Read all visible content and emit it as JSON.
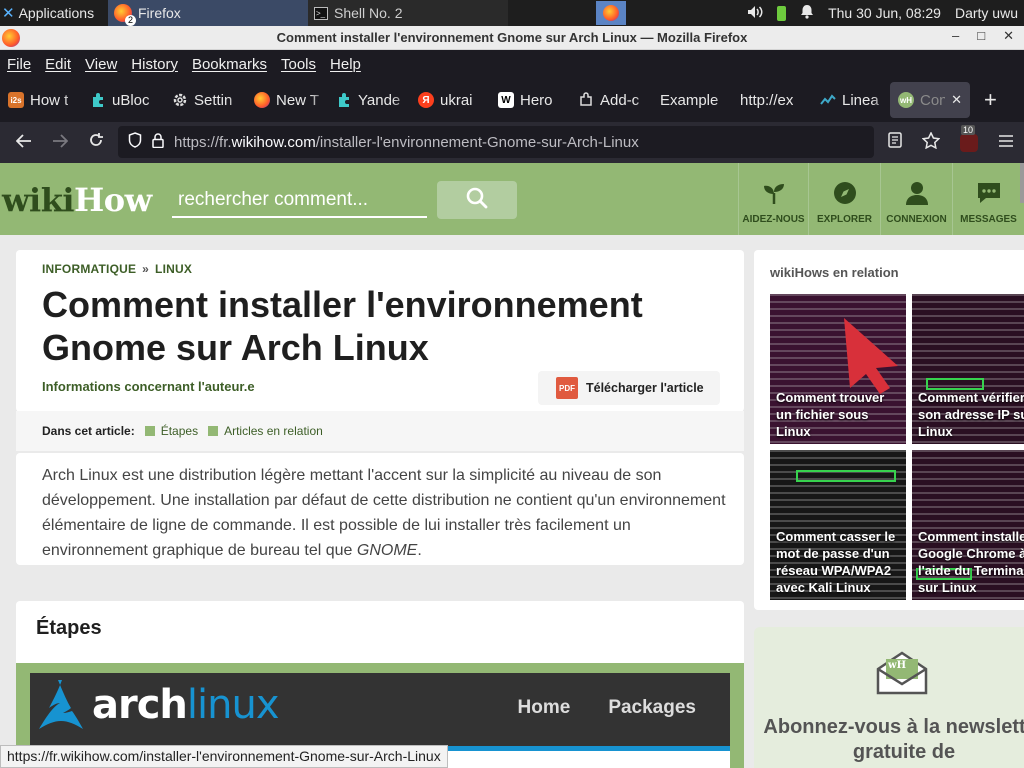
{
  "taskbar": {
    "applications": "Applications",
    "firefox_task": "Firefox",
    "firefox_count": "2",
    "shell_task": "Shell No. 2",
    "clock": "Thu 30 Jun, 08:29",
    "user": "Darty uwu"
  },
  "window": {
    "title": "Comment installer l'environnement Gnome sur Arch Linux — Mozilla Firefox",
    "controls": [
      "–",
      "□",
      "✕"
    ]
  },
  "menu": [
    "File",
    "Edit",
    "View",
    "History",
    "Bookmarks",
    "Tools",
    "Help"
  ],
  "tabs": [
    {
      "label": "How t",
      "icon": "i2s",
      "color": "#d8732b"
    },
    {
      "label": "uBloc",
      "icon": "puzzle",
      "color": "#3ec9c9"
    },
    {
      "label": "Settin",
      "icon": "gear",
      "color": "#dddddd"
    },
    {
      "label": "New T",
      "icon": "firefox",
      "color": "#ff7139"
    },
    {
      "label": "Yande",
      "icon": "puzzle",
      "color": "#3ec9c9"
    },
    {
      "label": "ukrai",
      "icon": "yandex",
      "color": "#fc3f1d"
    },
    {
      "label": "Hero",
      "icon": "wikipedia",
      "color": "#ffffff"
    },
    {
      "label": "Add-c",
      "icon": "addon",
      "color": "#dddddd"
    },
    {
      "label": "Example",
      "icon": "",
      "color": ""
    },
    {
      "label": "http://ex",
      "icon": "",
      "color": ""
    },
    {
      "label": "Linea",
      "icon": "chart",
      "color": "#3ea9c9"
    },
    {
      "label": "Con",
      "icon": "wikihow",
      "color": "#93b874",
      "active": true
    }
  ],
  "navbar": {
    "url_prefix": "https://fr.",
    "url_host": "wikihow.com",
    "url_path": "/installer-l'environnement-Gnome-sur-Arch-Linux",
    "ublock_count": "10"
  },
  "wikihow": {
    "logo_wiki": "wiki",
    "logo_how": "How",
    "search_placeholder": "rechercher comment...",
    "nav": [
      "AIDEZ-NOUS",
      "EXPLORER",
      "CONNEXION",
      "MESSAGES"
    ]
  },
  "article": {
    "crumb1": "INFORMATIQUE",
    "crumb_sep": "»",
    "crumb2": "LINUX",
    "title": "Comment installer l'environnement Gnome sur Arch Linux",
    "author": "Informations concernant l'auteur.e",
    "download": "Télécharger l'article",
    "pdf": "PDF",
    "toc_label": "Dans cet article:",
    "toc_items": [
      "Étapes",
      "Articles en relation"
    ],
    "intro": "Arch Linux est une distribution légère mettant l'accent sur la simplicité au niveau de son développement. Une installation par défaut de cette distribution ne contient qu'un environnement élémentaire de ligne de commande. Il est possible de lui installer très facilement un environnement graphique de bureau tel que ",
    "intro_em": "GNOME",
    "intro_end": ".",
    "steps_heading": "Étapes"
  },
  "arch_image": {
    "logo_a": "arch",
    "logo_b": "linux",
    "nav": [
      "Home",
      "Packages"
    ]
  },
  "sidebar": {
    "title": "wikiHows en relation",
    "related": [
      "Comment trouver un fichier sous Linux",
      "Comment vérifier son adresse IP sur Linux",
      "Comment casser le mot de passe d'un réseau WPA/WPA2 avec Kali Linux",
      "Comment installer Google Chrome à l'aide du Terminal sur Linux"
    ],
    "newsletter": "Abonnez-vous à la newsletter gratuite de",
    "newsletter_logo": "wH"
  },
  "status_url": "https://fr.wikihow.com/installer-l'environnement-Gnome-sur-Arch-Linux"
}
